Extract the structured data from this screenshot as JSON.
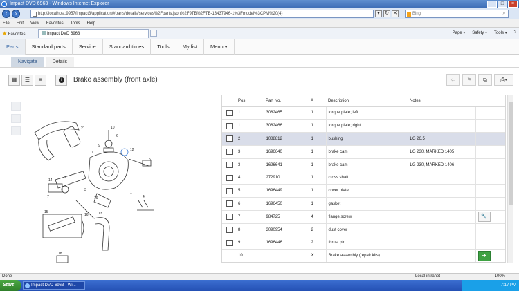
{
  "window": {
    "title": "Impact DVD 6963 - Windows Internet Explorer"
  },
  "address": {
    "url": "http://localhost:9957/impact3/application/#parts/details/services%2Fparts.json%2F9TB%2FTB-13437946-1%3Fmodel%3CPM%20(4)",
    "search_placeholder": "Bing"
  },
  "menu": [
    "File",
    "Edit",
    "View",
    "Favorites",
    "Tools",
    "Help"
  ],
  "favorites": {
    "label": "Favorites",
    "tab": "Impact DVD 6963",
    "tools": [
      "Page ▾",
      "Safety ▾",
      "Tools ▾",
      "?"
    ]
  },
  "app_tabs": [
    "Parts",
    "Standard parts",
    "Service",
    "Standard times",
    "Tools",
    "My list",
    "Menu ▾"
  ],
  "sub_tabs": [
    "Navigate",
    "Details"
  ],
  "page_title": "Brake assembly (front axle)",
  "table": {
    "headers": {
      "pos": "Pos",
      "part": "Part No.",
      "a": "A",
      "desc": "Description",
      "notes": "Notes"
    },
    "rows": [
      {
        "pos": "1",
        "part": "3082465",
        "a": "1",
        "desc": "torque plate; left",
        "notes": ""
      },
      {
        "pos": "1",
        "part": "3082466",
        "a": "1",
        "desc": "torque plate; right",
        "notes": ""
      },
      {
        "pos": "2",
        "part": "1088812",
        "a": "1",
        "desc": "bushing",
        "notes": "LG 26,5"
      },
      {
        "pos": "3",
        "part": "1696640",
        "a": "1",
        "desc": "brake cam",
        "notes": "LG 230, MARKED 1405"
      },
      {
        "pos": "3",
        "part": "1696641",
        "a": "1",
        "desc": "brake cam",
        "notes": "LG 230, MARKED 1406"
      },
      {
        "pos": "4",
        "part": "272910",
        "a": "1",
        "desc": "cross shaft",
        "notes": ""
      },
      {
        "pos": "5",
        "part": "1696449",
        "a": "1",
        "desc": "cover plate",
        "notes": ""
      },
      {
        "pos": "6",
        "part": "1696450",
        "a": "1",
        "desc": "gasket",
        "notes": ""
      },
      {
        "pos": "7",
        "part": "984725",
        "a": "4",
        "desc": "flange screw",
        "notes": ""
      },
      {
        "pos": "8",
        "part": "3090954",
        "a": "2",
        "desc": "dust cover",
        "notes": ""
      },
      {
        "pos": "9",
        "part": "1696446",
        "a": "2",
        "desc": "thrust pin",
        "notes": ""
      },
      {
        "pos": "10",
        "part": "",
        "a": "X",
        "desc": "Brake assembly (repair kits)",
        "notes": ""
      }
    ]
  },
  "diagram_labels": [
    "21",
    "10",
    "6",
    "9",
    "11",
    "12",
    "5",
    "14",
    "8",
    "3",
    "7",
    "19",
    "1",
    "4",
    "15",
    "16",
    "13",
    "18"
  ],
  "status": {
    "text": "Done",
    "zone": "Local intranet",
    "zoom": "100%"
  },
  "taskbar": {
    "start": "Start",
    "item": "Impact DVD 6963 - Wi...",
    "time": "7:17 PM"
  },
  "colors": {
    "selected_row": "#d9dde9",
    "green_action": "#3ea142",
    "active_tab_text": "#3a6aa8"
  }
}
